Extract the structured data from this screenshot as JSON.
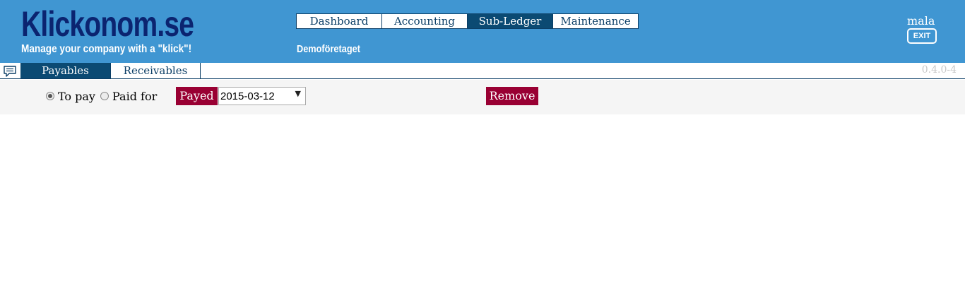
{
  "header": {
    "brand_title": "Klickonom.se",
    "brand_tagline": "Manage your company with a \"klick\"!",
    "company": "Demoföretaget",
    "username": "mala",
    "exit_label": "EXIT"
  },
  "main_nav": {
    "tabs": [
      {
        "label": "Dashboard",
        "active": false
      },
      {
        "label": "Accounting",
        "active": false
      },
      {
        "label": "Sub-Ledger",
        "active": true
      },
      {
        "label": "Maintenance",
        "active": false
      }
    ]
  },
  "sub_nav": {
    "icon": "chat-icon",
    "tabs": [
      {
        "label": "Payables",
        "active": true
      },
      {
        "label": "Receivables",
        "active": false
      }
    ],
    "version": "0.4.0-4"
  },
  "filter": {
    "radios": [
      {
        "label": "To pay",
        "checked": true
      },
      {
        "label": "Paid for",
        "checked": false
      }
    ],
    "payed_label": "Payed",
    "date_value": "2015-03-12",
    "remove_label": "Remove"
  },
  "colors": {
    "header_bg": "#4096d2",
    "brand": "#0b2470",
    "nav_active": "#0b4a73",
    "action": "#990033"
  }
}
